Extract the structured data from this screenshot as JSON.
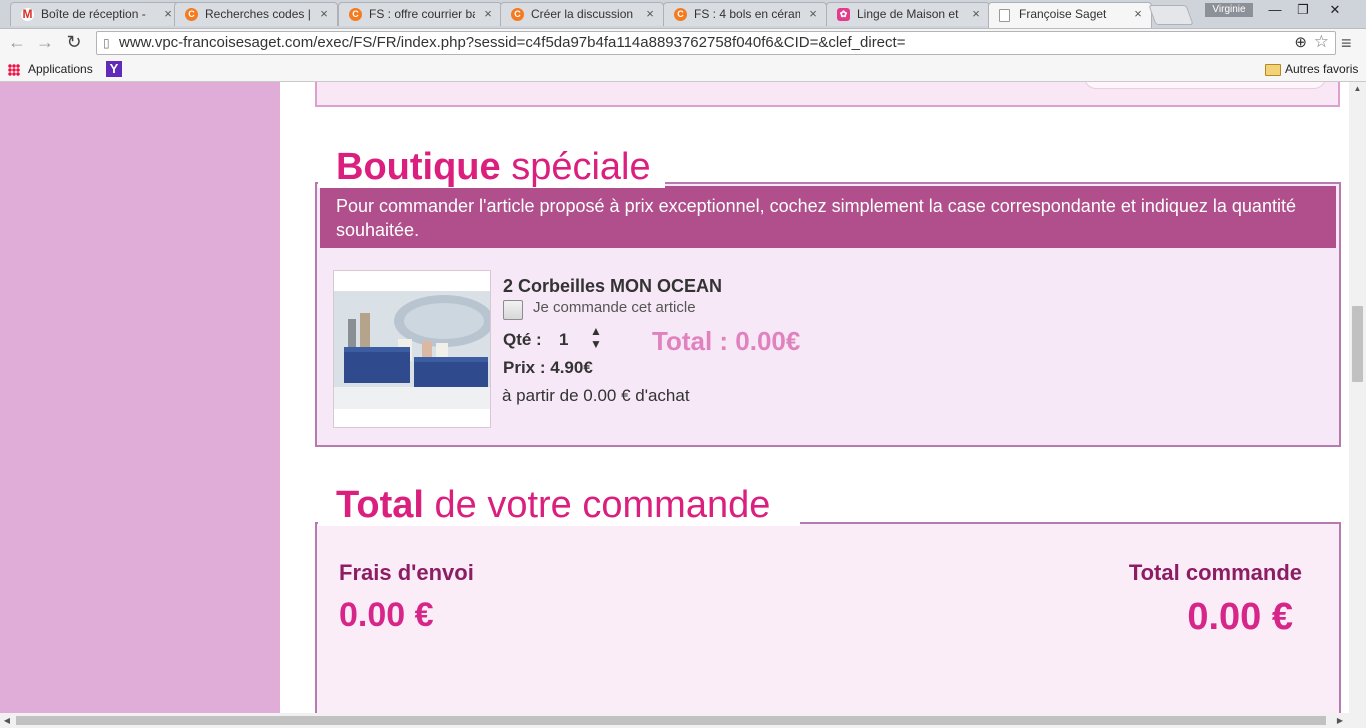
{
  "browser": {
    "tabs": [
      {
        "title": "Boîte de réception -",
        "favicon": "gmail-icon",
        "color": "#d93025",
        "letter": "M"
      },
      {
        "title": "Recherches codes |",
        "favicon": "coupon-site-icon",
        "color": "#f47b20",
        "letter": "C"
      },
      {
        "title": "FS : offre courrier ba",
        "favicon": "coupon-site-icon",
        "color": "#f47b20",
        "letter": "C"
      },
      {
        "title": "Créer la discussion",
        "favicon": "coupon-site-icon",
        "color": "#f47b20",
        "letter": "C"
      },
      {
        "title": "FS : 4 bols en céram",
        "favicon": "coupon-site-icon",
        "color": "#f47b20",
        "letter": "C"
      },
      {
        "title": "Linge de Maison et",
        "favicon": "flower-icon",
        "color": "#e23c8c",
        "letter": "✿"
      },
      {
        "title": "Françoise Saget",
        "favicon": "page-icon",
        "color": "#ffffff",
        "letter": ""
      }
    ],
    "tab_close": "×",
    "profile": "Virginie",
    "window_controls": {
      "minimize": "—",
      "restore": "❐",
      "close": "✕"
    },
    "nav": {
      "back": "←",
      "forward": "→",
      "reload": "↻"
    },
    "url": "www.vpc-francoisesaget.com/exec/FS/FR/index.php?sessid=c4f5da97b4fa114a8893762758f040f6&CID=&clef_direct=",
    "zoom_icon": "⊕",
    "star_icon": "☆",
    "menu_icon": "≡",
    "bookmarks": {
      "apps": "Applications",
      "yahoo": "Y",
      "other": "Autres favoris"
    }
  },
  "boutique": {
    "title_bold": "Boutique",
    "title_light": "spéciale",
    "banner": "Pour commander l'article proposé à prix exceptionnel, cochez simplement la case correspondante et indiquez la quantité souhaitée.",
    "product": {
      "name": "2 Corbeilles MON OCEAN",
      "checkbox_label": "Je commande cet article",
      "checked": false,
      "qty_label": "Qté :",
      "qty": "1",
      "total": "Total : 0.00€",
      "price": "Prix : 4.90€",
      "min_purchase": "à partir de 0.00 € d'achat"
    }
  },
  "order_total": {
    "title_bold": "Total",
    "title_light": "de votre commande",
    "shipping_label": "Frais d'envoi",
    "shipping_value": "0.00 €",
    "total_label": "Total commande",
    "total_value": "0.00 €"
  },
  "scroll": {
    "up": "▲",
    "down": "▼",
    "left": "◀",
    "right": "▶"
  },
  "colors": {
    "brand_pink": "#da1f7e",
    "banner": "#b04f8b",
    "sidebar": "#e0acd8",
    "box_border": "#b57bb0",
    "box_bg": "#f6e8f6"
  }
}
